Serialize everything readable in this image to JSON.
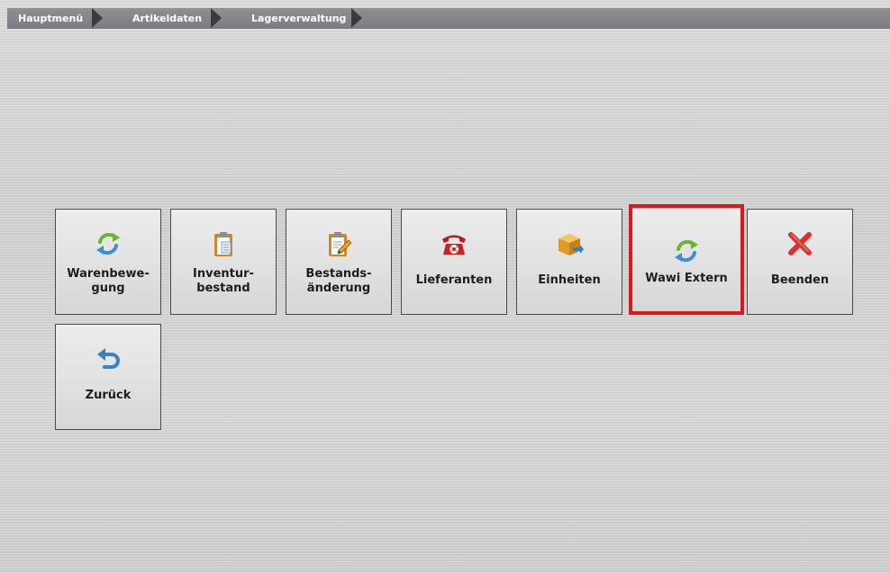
{
  "breadcrumb": {
    "items": [
      {
        "label": "Hauptmenü"
      },
      {
        "label": "Artikeldaten"
      },
      {
        "label": "Lagerverwaltung"
      }
    ]
  },
  "tiles": [
    {
      "label": "Warenbewe-\ngung",
      "icon": "refresh-arrows-icon"
    },
    {
      "label": "Inventur-\nbestand",
      "icon": "clipboard-icon"
    },
    {
      "label": "Bestands-\nänderung",
      "icon": "clipboard-pencil-icon"
    },
    {
      "label": "Lieferanten",
      "icon": "telephone-icon"
    },
    {
      "label": "Einheiten",
      "icon": "box-icon"
    },
    {
      "label": "Wawi Extern",
      "icon": "refresh-arrows-icon",
      "selected": true
    },
    {
      "label": "Beenden",
      "icon": "close-x-icon"
    },
    {
      "label": "Zurück",
      "icon": "undo-arrow-icon"
    }
  ],
  "colors": {
    "selection_border": "#e0161b",
    "breadcrumb_bar": "#85858c",
    "tile_border": "#4a4a4a"
  }
}
